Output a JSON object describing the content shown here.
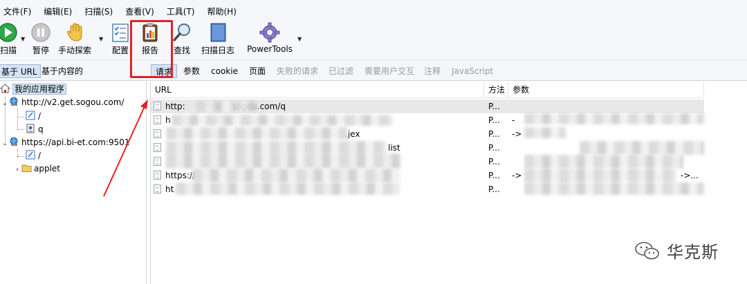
{
  "menu": [
    "文件(F)",
    "编辑(E)",
    "扫描(S)",
    "查看(V)",
    "工具(T)",
    "帮助(H)"
  ],
  "toolbar": {
    "scan": "扫描",
    "pause": "暂停",
    "manual": "手动探索",
    "config": "配置",
    "report": "报告",
    "find": "查找",
    "log": "扫描日志",
    "powertools": "PowerTools"
  },
  "left_tabs": [
    "基于 URL",
    "基于内容的"
  ],
  "right_tabs": [
    "请求",
    "参数",
    "cookie",
    "页面",
    "失败的请求",
    "已过滤",
    "需要用户交互",
    "注释",
    "JavaScript"
  ],
  "tree": {
    "root": "我的应用程序",
    "site1": "http://v2.get.sogou.com/",
    "site1_children": [
      "/",
      "q"
    ],
    "site2": "https://api.bi-et.com:9501",
    "site2_children": [
      "/",
      "applet"
    ]
  },
  "table": {
    "headers": [
      "URL",
      "方法",
      "参数"
    ],
    "rows": [
      {
        "url": "http:",
        "url_tail": "sogou.com/q",
        "method": "P...",
        "params": ""
      },
      {
        "url": "h",
        "url_tail": "",
        "method": "P...",
        "params": "-"
      },
      {
        "url": "",
        "url_tail": ".jex",
        "method": "P...",
        "params": "->"
      },
      {
        "url": "",
        "url_tail": "list",
        "method": "P...",
        "params": ""
      },
      {
        "url": "",
        "url_tail": "",
        "method": "P...",
        "params": ""
      },
      {
        "url": "https://",
        "url_tail": "",
        "method": "P...",
        "params": "->",
        "params_tail": "->..."
      },
      {
        "url": "ht",
        "url_tail": "",
        "method": "P...",
        "params": ""
      }
    ]
  },
  "watermark": "华克斯",
  "colors": {
    "highlight": "#e32222",
    "selection": "#d5e3f5"
  }
}
